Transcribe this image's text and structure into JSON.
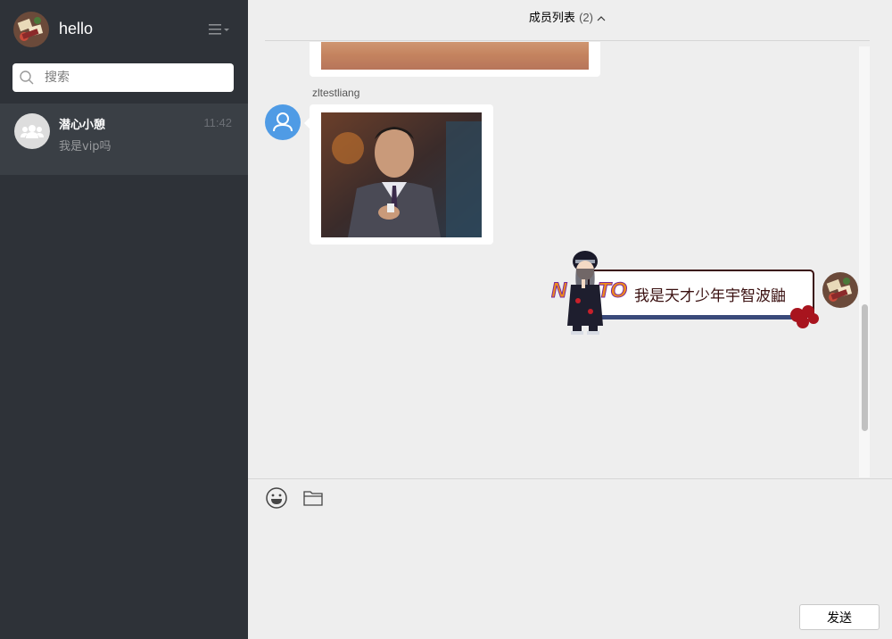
{
  "sidebar": {
    "user_name": "hello",
    "search_placeholder": "搜索",
    "conversations": [
      {
        "name": "潜心小憩",
        "time": "11:42",
        "last_message": "我是vip吗"
      }
    ]
  },
  "chat": {
    "header_title": "成员列表",
    "member_count": "(2)",
    "messages": [
      {
        "type": "image",
        "from": "other",
        "sender_name": ""
      },
      {
        "type": "image",
        "from": "other",
        "sender_name": "zltestliang"
      },
      {
        "type": "sticker_text",
        "from": "self",
        "text": "我是天才少年宇智波鼬"
      }
    ]
  },
  "composer": {
    "send_label": "发送"
  },
  "colors": {
    "sidebar_bg": "#2e3238",
    "active_item_bg": "#3a3f45",
    "main_bg": "#eeeeee",
    "avatar_blue": "#4f9be5"
  },
  "icons": [
    "menu-icon",
    "search-icon",
    "group-icon",
    "caret-up-icon",
    "user-icon",
    "emoji-icon",
    "folder-icon"
  ]
}
